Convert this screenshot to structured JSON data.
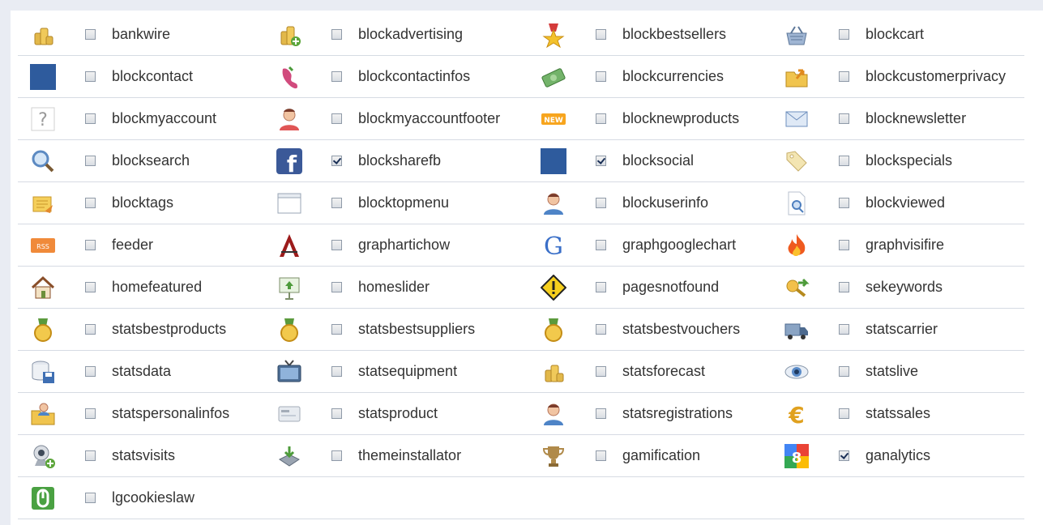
{
  "modules": [
    [
      {
        "name": "bankwire",
        "icon": "coins-icon",
        "checked": false
      },
      {
        "name": "blockadvertising",
        "icon": "coins-add-icon",
        "checked": false
      },
      {
        "name": "blockbestsellers",
        "icon": "medal-star-icon",
        "checked": false
      },
      {
        "name": "blockcart",
        "icon": "basket-icon",
        "checked": false
      }
    ],
    [
      {
        "name": "blockcontact",
        "icon": "blue-square-icon",
        "checked": false
      },
      {
        "name": "blockcontactinfos",
        "icon": "phone-icon",
        "checked": false
      },
      {
        "name": "blockcurrencies",
        "icon": "banknote-icon",
        "checked": false
      },
      {
        "name": "blockcustomerprivacy",
        "icon": "folder-arrow-icon",
        "checked": false
      }
    ],
    [
      {
        "name": "blockmyaccount",
        "icon": "question-icon",
        "checked": false
      },
      {
        "name": "blockmyaccountfooter",
        "icon": "user-icon",
        "checked": false
      },
      {
        "name": "blocknewproducts",
        "icon": "new-badge-icon",
        "checked": false
      },
      {
        "name": "blocknewsletter",
        "icon": "envelope-icon",
        "checked": false
      }
    ],
    [
      {
        "name": "blocksearch",
        "icon": "magnifier-icon",
        "checked": false
      },
      {
        "name": "blocksharefb",
        "icon": "facebook-icon",
        "checked": true
      },
      {
        "name": "blocksocial",
        "icon": "blue-square-icon",
        "checked": true
      },
      {
        "name": "blockspecials",
        "icon": "tag-icon",
        "checked": false
      }
    ],
    [
      {
        "name": "blocktags",
        "icon": "tag-note-icon",
        "checked": false
      },
      {
        "name": "blocktopmenu",
        "icon": "window-icon",
        "checked": false
      },
      {
        "name": "blockuserinfo",
        "icon": "user-blue-icon",
        "checked": false
      },
      {
        "name": "blockviewed",
        "icon": "page-magnifier-icon",
        "checked": false
      }
    ],
    [
      {
        "name": "feeder",
        "icon": "rss-icon",
        "checked": false
      },
      {
        "name": "graphartichow",
        "icon": "artichow-icon",
        "checked": false
      },
      {
        "name": "graphgooglechart",
        "icon": "google-g-icon",
        "checked": false
      },
      {
        "name": "graphvisifire",
        "icon": "fire-icon",
        "checked": false
      }
    ],
    [
      {
        "name": "homefeatured",
        "icon": "house-icon",
        "checked": false
      },
      {
        "name": "homeslider",
        "icon": "slideshow-icon",
        "checked": false
      },
      {
        "name": "pagesnotfound",
        "icon": "warning-icon",
        "checked": false
      },
      {
        "name": "sekeywords",
        "icon": "key-arrow-icon",
        "checked": false
      }
    ],
    [
      {
        "name": "statsbestproducts",
        "icon": "gold-medal-icon",
        "checked": false
      },
      {
        "name": "statsbestsuppliers",
        "icon": "gold-medal-icon",
        "checked": false
      },
      {
        "name": "statsbestvouchers",
        "icon": "gold-medal-icon",
        "checked": false
      },
      {
        "name": "statscarrier",
        "icon": "truck-icon",
        "checked": false
      }
    ],
    [
      {
        "name": "statsdata",
        "icon": "database-save-icon",
        "checked": false
      },
      {
        "name": "statsequipment",
        "icon": "tv-icon",
        "checked": false
      },
      {
        "name": "statsforecast",
        "icon": "coins-icon",
        "checked": false
      },
      {
        "name": "statslive",
        "icon": "eye-icon",
        "checked": false
      }
    ],
    [
      {
        "name": "statspersonalinfos",
        "icon": "folder-user-icon",
        "checked": false
      },
      {
        "name": "statsproduct",
        "icon": "card-icon",
        "checked": false
      },
      {
        "name": "statsregistrations",
        "icon": "user-blue-icon",
        "checked": false
      },
      {
        "name": "statssales",
        "icon": "euro-icon",
        "checked": false
      }
    ],
    [
      {
        "name": "statsvisits",
        "icon": "webcam-add-icon",
        "checked": false
      },
      {
        "name": "themeinstallator",
        "icon": "install-arrow-icon",
        "checked": false
      },
      {
        "name": "gamification",
        "icon": "trophy-icon",
        "checked": false
      },
      {
        "name": "ganalytics",
        "icon": "google-analytics-icon",
        "checked": true
      }
    ],
    [
      {
        "name": "lgcookieslaw",
        "icon": "cookie-icon",
        "checked": false
      }
    ]
  ],
  "colors": {
    "accent_blue": "#2e5b9d",
    "border": "#d6dbe3",
    "text": "#333333"
  }
}
